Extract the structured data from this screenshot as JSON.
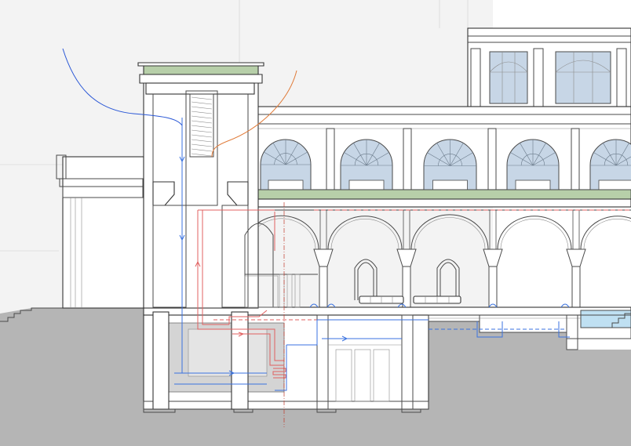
{
  "colors": {
    "background": "#ffffff",
    "backdrop_building": "#f3f3f3",
    "ground": "#b5b5b5",
    "green_roof": "#b7cfa9",
    "glazing": "#c7d6e6",
    "pool_water": "#bfe0f2",
    "linework": "#4a4a4a",
    "warm_air_flow": "#e07b39",
    "cool_air_flow": "#2b58d6",
    "warm_duct": "#e06060",
    "cool_duct": "#3a72e0",
    "section_line": "#c0392b",
    "duct_zone": "#d4d4d4"
  },
  "annotations": {
    "section_cut_label": ""
  }
}
